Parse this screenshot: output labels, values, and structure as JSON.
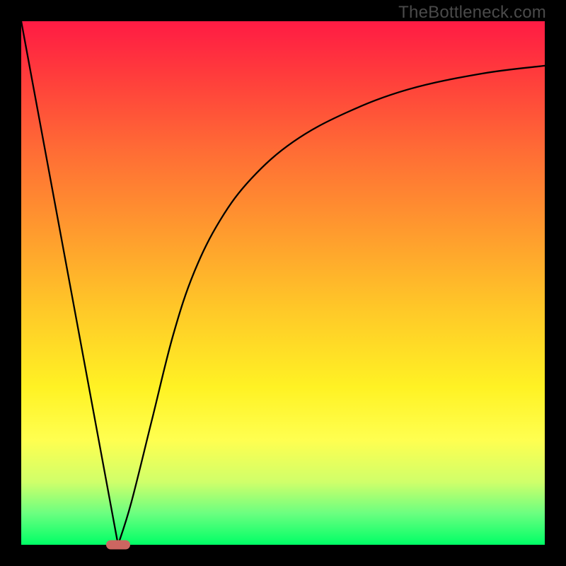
{
  "watermark": "TheBottleneck.com",
  "chart_data": {
    "type": "line",
    "title": "",
    "xlabel": "",
    "ylabel": "",
    "x_range": [
      0,
      1
    ],
    "y_range": [
      0,
      100
    ],
    "series": [
      {
        "name": "curve",
        "x": [
          0.0,
          0.04,
          0.08,
          0.12,
          0.16,
          0.185,
          0.21,
          0.25,
          0.29,
          0.33,
          0.38,
          0.44,
          0.52,
          0.62,
          0.74,
          0.88,
          1.0
        ],
        "y": [
          100,
          80,
          58,
          36,
          14,
          0,
          8,
          24,
          40,
          52,
          62,
          70,
          77,
          82.5,
          87,
          90,
          91.5
        ]
      }
    ],
    "marker": {
      "x": 0.185,
      "y": 0
    },
    "gradient_background": {
      "top": "#ff1b44",
      "bottom": "#00ff66",
      "stops": [
        "#ff1b44",
        "#ff3b3c",
        "#ff6d35",
        "#ff9a2e",
        "#ffc828",
        "#fff224",
        "#ffff50",
        "#d0ff6a",
        "#6bff80",
        "#00ff66"
      ]
    },
    "axes_visible": false
  }
}
